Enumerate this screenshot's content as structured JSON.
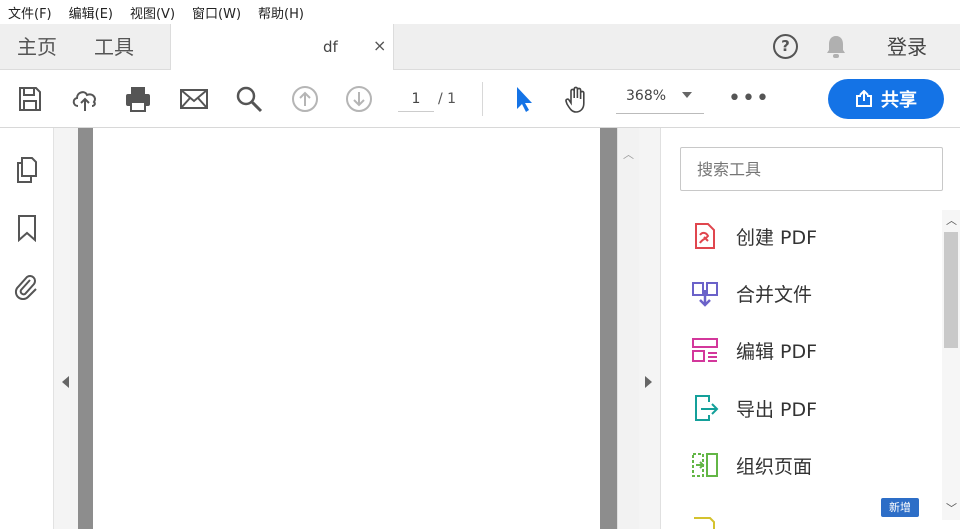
{
  "menubar": {
    "items": [
      "文件(F)",
      "编辑(E)",
      "视图(V)",
      "窗口(W)",
      "帮助(H)"
    ]
  },
  "tabs": {
    "home": "主页",
    "tools": "工具",
    "document_name": "df",
    "close_glyph": "×",
    "login": "登录",
    "help_glyph": "?"
  },
  "toolbar": {
    "page_current": "1",
    "page_total": "/ 1",
    "zoom": "368%",
    "more": "•••",
    "share_label": "共享"
  },
  "tools_pane": {
    "search_placeholder": "搜索工具",
    "items": [
      {
        "label": "创建 PDF",
        "icon": "create-pdf-icon",
        "color": "#e0464e"
      },
      {
        "label": "合并文件",
        "icon": "combine-files-icon",
        "color": "#6b62c9"
      },
      {
        "label": "编辑 PDF",
        "icon": "edit-pdf-icon",
        "color": "#d3379b"
      },
      {
        "label": "导出 PDF",
        "icon": "export-pdf-icon",
        "color": "#14a09a"
      },
      {
        "label": "组织页面",
        "icon": "organize-pages-icon",
        "color": "#63b646"
      }
    ],
    "new_badge": "新增"
  },
  "colors": {
    "accent": "#1473e6",
    "document_gutter": "#8d8d8d",
    "tab_bar": "#efefef"
  }
}
